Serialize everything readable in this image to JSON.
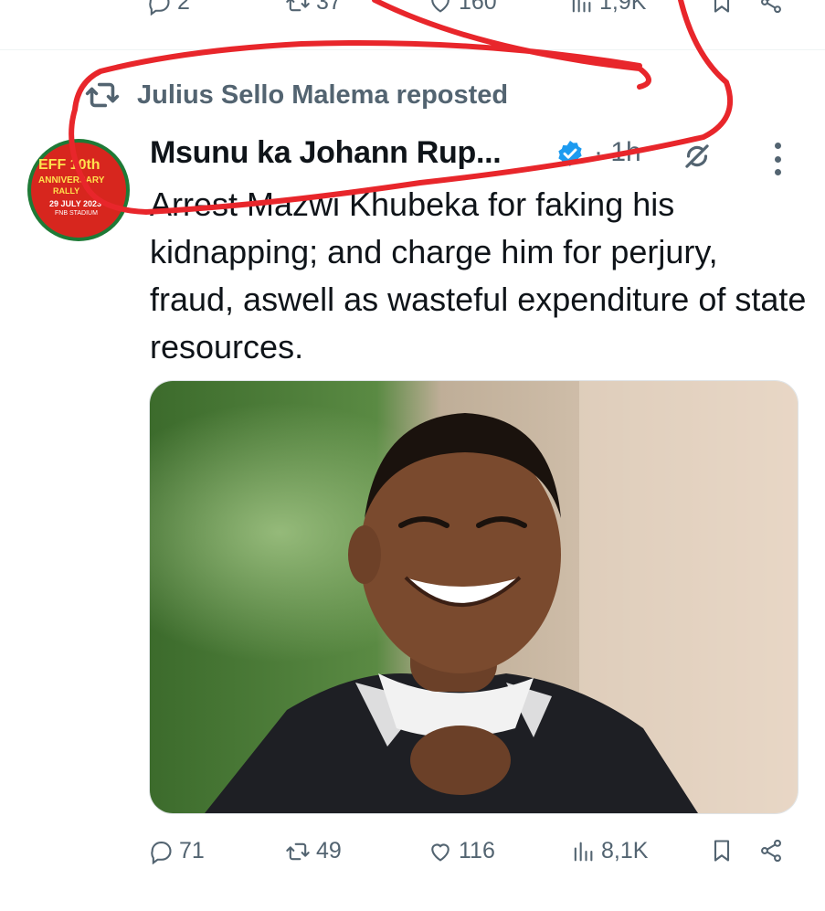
{
  "previous_tweet": {
    "actions": {
      "replies": "2",
      "reposts": "37",
      "likes": "160",
      "views": "1,9K"
    }
  },
  "social_context": {
    "text": "Julius Sello Malema reposted",
    "icon": "repost-icon"
  },
  "tweet": {
    "author_name": "Msunu ka Johann Rup...",
    "verified": true,
    "time": "· 1h",
    "text": "Arrest Mazwi Khubeka for faking his kidnapping; and charge him for perjury, fraud, aswell as wasteful expenditure of state resources.",
    "avatar": {
      "line1": "EFF 10th",
      "line2": "ANNIVERSARY",
      "line3": "RALLY",
      "line4": "29 JULY 2023",
      "line5": "FNB STADIUM"
    },
    "actions": {
      "replies": "71",
      "reposts": "49",
      "likes": "116",
      "views": "8,1K"
    }
  },
  "colors": {
    "text_primary": "#0f1419",
    "text_secondary": "#536471",
    "verified_blue": "#1d9bf0",
    "annotation_red": "#e8262b"
  },
  "icons": [
    "reply-icon",
    "repost-icon",
    "like-icon",
    "views-icon",
    "bookmark-icon",
    "share-icon",
    "verified-icon",
    "grok-icon",
    "more-icon"
  ]
}
